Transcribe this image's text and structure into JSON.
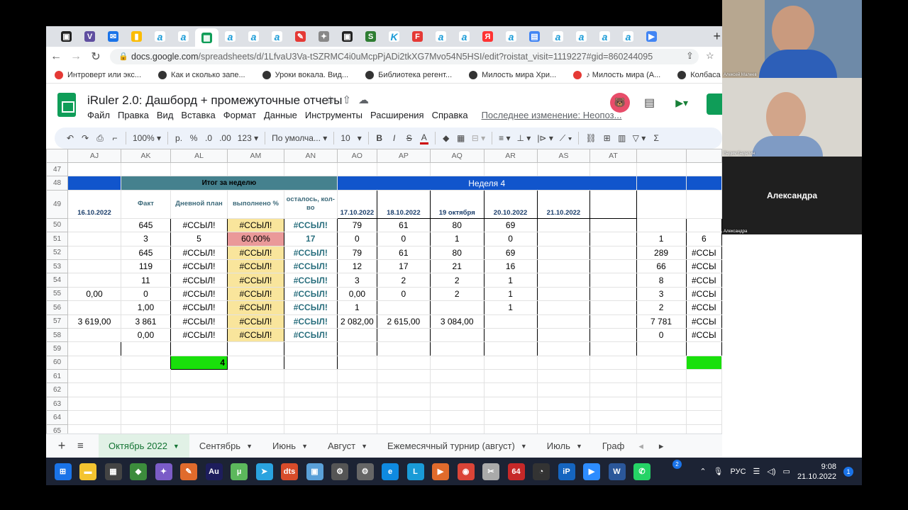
{
  "browser": {
    "tab_icons": [
      "tab-icon",
      "v-icon",
      "mail-icon",
      "y-icon",
      "a-icon",
      "a-icon",
      "sheets-icon",
      "a-icon",
      "a-icon",
      "a-icon",
      "red-icon",
      "compass-icon",
      "tab-icon",
      "s-icon",
      "k-icon",
      "f-icon",
      "a-icon",
      "a-icon",
      "ya-icon",
      "a-icon",
      "doc-icon",
      "a-icon",
      "a-icon",
      "a-icon",
      "a-icon",
      "meet-icon"
    ],
    "url_host": "docs.google.com",
    "url_path": "/spreadsheets/d/1LfvaU3Va-tSZRMC4i0uMcpPjADi2tkXG7Mvo54N5HSI/edit?roistat_visit=1119227#gid=860244095",
    "bookmarks": [
      "Интроверт или экс...",
      "Как и сколько запе...",
      "Уроки вокала. Вид...",
      "Библиотека регент...",
      "Милость мира Хри...",
      "♪ Милость мира (А...",
      "Колбаса сырокопч..."
    ]
  },
  "doc": {
    "title": "iRuler 2.0: Дашборд + промежуточные отчеты",
    "menu": [
      "Файл",
      "Правка",
      "Вид",
      "Вставка",
      "Формат",
      "Данные",
      "Инструменты",
      "Расширения",
      "Справка"
    ],
    "last_edit": "Последнее изменение: Неопоз..."
  },
  "toolbar": {
    "zoom": "100%",
    "currency": "р.",
    "percent": "%",
    "dec_less": ".0",
    "dec_more": ".00",
    "format": "123",
    "font": "По умолча...",
    "size": "10",
    "bold": "B",
    "italic": "I",
    "strike": "S",
    "textcolor": "A"
  },
  "grid": {
    "col_headers": [
      "AJ",
      "AK",
      "AL",
      "AM",
      "AN",
      "AO",
      "AP",
      "AQ",
      "AR",
      "AS",
      "AT"
    ],
    "row_numbers": [
      "47",
      "48",
      "49",
      "50",
      "51",
      "52",
      "53",
      "54",
      "55",
      "56",
      "57",
      "58",
      "59",
      "60",
      "61",
      "62",
      "63",
      "64",
      "65"
    ],
    "itog_label": "Итог за неделю",
    "week_label": "Неделя 4",
    "h_date_aj": "16.10.2022",
    "h_fact": "Факт",
    "h_plan": "Дневной план",
    "h_done": "выполнено %",
    "h_left": "осталось, кол-во",
    "h_ao": "17.10.2022",
    "h_ap": "18.10.2022",
    "h_aq": "19 октября",
    "h_ar": "20.10.2022",
    "h_as": "21.10.2022",
    "rows": [
      {
        "aj": "",
        "ak": "645",
        "al": "#ССЫЛ!",
        "am": "#ССЫЛ!",
        "an": "#ССЫЛ!",
        "ao": "79",
        "ap": "61",
        "aq": "80",
        "ar": "69",
        "x1": "",
        "x2": ""
      },
      {
        "aj": "",
        "ak": "3",
        "al": "5",
        "am": "60,00%",
        "an": "17",
        "ao": "0",
        "ap": "0",
        "aq": "1",
        "ar": "0",
        "x1": "1",
        "x2": "6"
      },
      {
        "aj": "",
        "ak": "645",
        "al": "#ССЫЛ!",
        "am": "#ССЫЛ!",
        "an": "#ССЫЛ!",
        "ao": "79",
        "ap": "61",
        "aq": "80",
        "ar": "69",
        "x1": "289",
        "x2": "#ССЫ"
      },
      {
        "aj": "",
        "ak": "119",
        "al": "#ССЫЛ!",
        "am": "#ССЫЛ!",
        "an": "#ССЫЛ!",
        "ao": "12",
        "ap": "17",
        "aq": "21",
        "ar": "16",
        "x1": "66",
        "x2": "#ССЫ"
      },
      {
        "aj": "",
        "ak": "11",
        "al": "#ССЫЛ!",
        "am": "#ССЫЛ!",
        "an": "#ССЫЛ!",
        "ao": "3",
        "ap": "2",
        "aq": "2",
        "ar": "1",
        "x1": "8",
        "x2": "#ССЫ"
      },
      {
        "aj": "0,00",
        "ak": "0",
        "al": "#ССЫЛ!",
        "am": "#ССЫЛ!",
        "an": "#ССЫЛ!",
        "ao": "0,00",
        "ap": "0",
        "aq": "2",
        "ar": "1",
        "x1": "3",
        "x2": "#ССЫ"
      },
      {
        "aj": "",
        "ak": "1,00",
        "al": "#ССЫЛ!",
        "am": "#ССЫЛ!",
        "an": "#ССЫЛ!",
        "ao": "1",
        "ap": "",
        "aq": "",
        "ar": "1",
        "x1": "2",
        "x2": "#ССЫ"
      },
      {
        "aj": "3 619,00",
        "ak": "3 861",
        "al": "#ССЫЛ!",
        "am": "#ССЫЛ!",
        "an": "#ССЫЛ!",
        "ao": "2 082,00",
        "ap": "2 615,00",
        "aq": "3 084,00",
        "ar": "",
        "x1": "7 781",
        "x2": "#ССЫ"
      },
      {
        "aj": "",
        "ak": "0,00",
        "al": "#ССЫЛ!",
        "am": "#ССЫЛ!",
        "an": "#ССЫЛ!",
        "ao": "",
        "ap": "",
        "aq": "",
        "ar": "",
        "x1": "0",
        "x2": "#ССЫ"
      }
    ],
    "green_value": "4"
  },
  "sheet_tabs": [
    "Октябрь 2022",
    "Сентябрь",
    "Июнь",
    "Август",
    "Ежемесячный турнир (август)",
    "Июль",
    "Граф"
  ],
  "taskbar": {
    "lang": "РУС",
    "time": "9:08",
    "date": "21.10.2022",
    "badge": "2",
    "notif": "1"
  },
  "video": {
    "tile1_name": "Алексей Малеев",
    "tile2_name": "Вадим Баделин",
    "tile3_big": "Александра",
    "tile3_small": "Александра"
  },
  "colors": {
    "blue_header": "#1155cc",
    "teal_header": "#45818e",
    "yellow_cell": "#f9e59c",
    "pink_cell": "#ea9999",
    "green_cell": "#19e00b"
  }
}
